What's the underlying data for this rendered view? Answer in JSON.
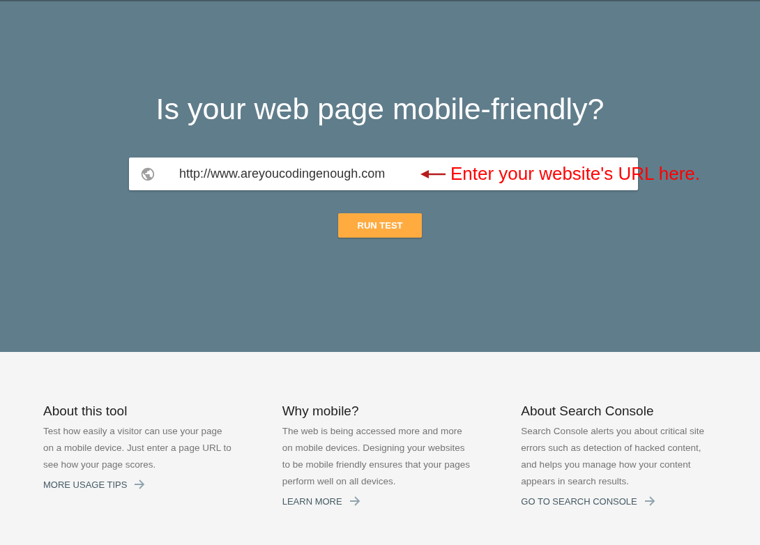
{
  "hero": {
    "title": "Is your web page mobile-friendly?",
    "url_field": {
      "value": "http://www.areyoucodingenough.com"
    },
    "annotation": "Enter your website's URL here.",
    "button": "RUN TEST"
  },
  "info_columns": [
    {
      "heading": "About this tool",
      "text": "Test how easily a visitor can use your page on a mobile device. Just enter a page URL to see how your page scores.",
      "link": "MORE USAGE TIPS"
    },
    {
      "heading": "Why mobile?",
      "text": "The web is being accessed more and more on mobile devices. Designing your websites to be mobile friendly ensures that your pages perform well on all devices.",
      "link": "LEARN MORE"
    },
    {
      "heading": "About Search Console",
      "text": "Search Console alerts you about critical site errors such as detection of hacked content, and helps you manage how your content appears in search results.",
      "link": "GO TO SEARCH CONSOLE"
    }
  ]
}
